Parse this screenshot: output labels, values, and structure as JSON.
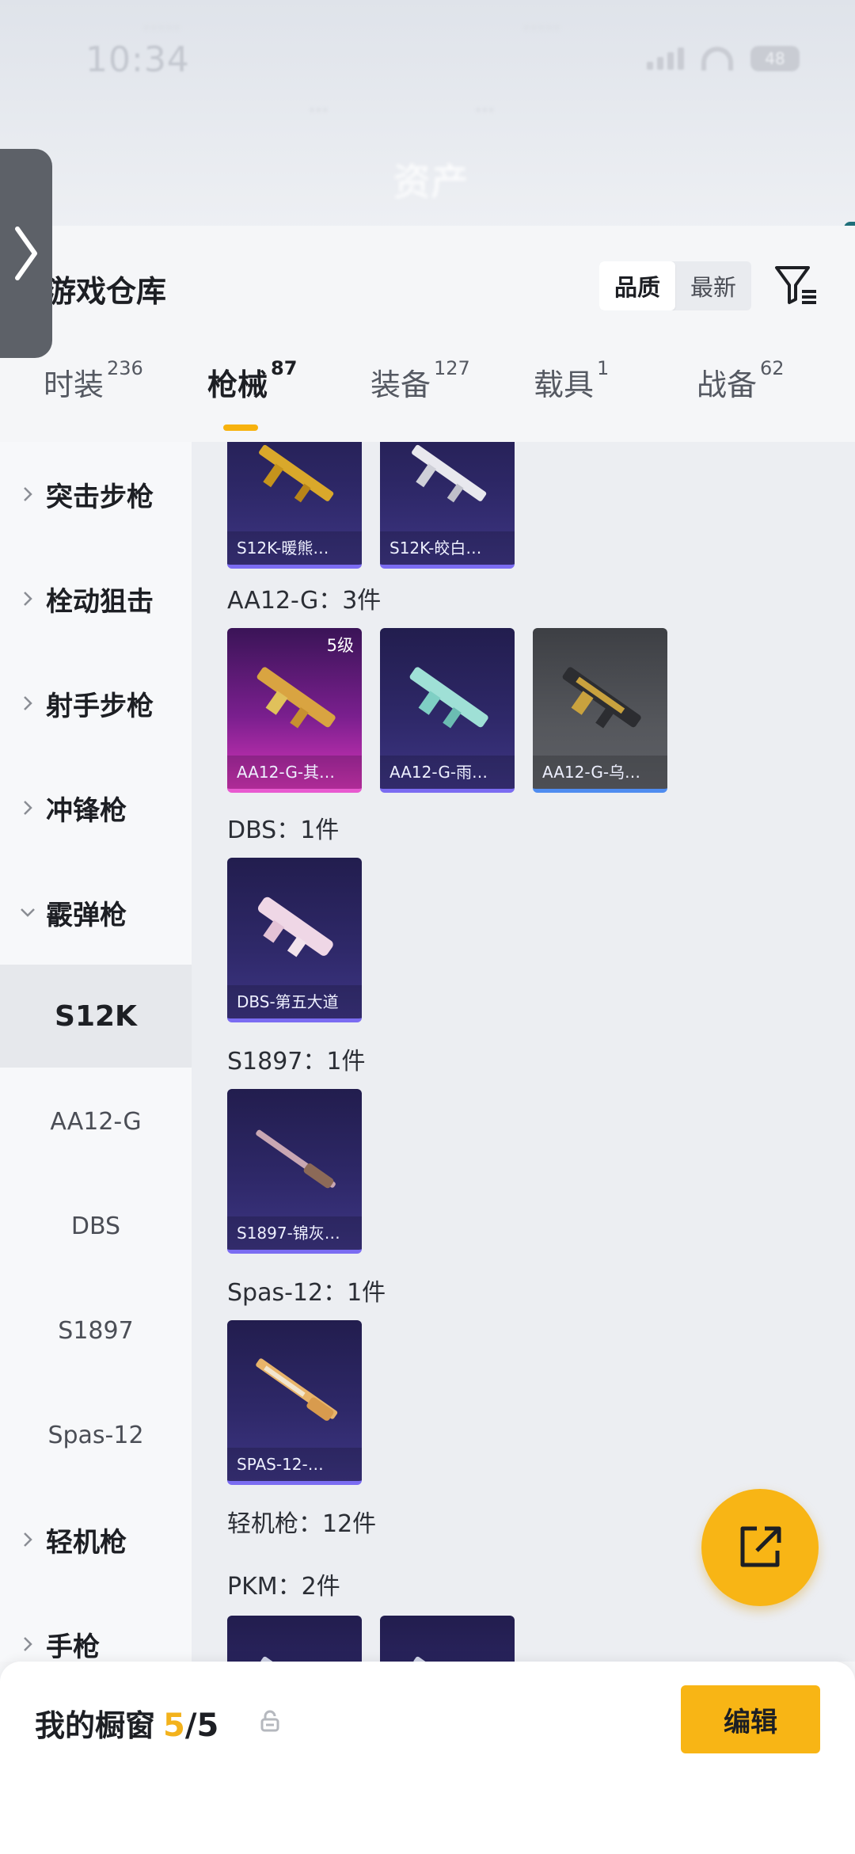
{
  "status": {
    "time": "10:34",
    "battery": "48"
  },
  "backdrop": {
    "title": "资产"
  },
  "header": {
    "title": "游戏仓库",
    "sort_options": [
      "品质",
      "最新"
    ]
  },
  "tabs": [
    {
      "label": "时装",
      "count": "236"
    },
    {
      "label": "枪械",
      "count": "87"
    },
    {
      "label": "装备",
      "count": "127"
    },
    {
      "label": "载具",
      "count": "1"
    },
    {
      "label": "战备",
      "count": "62"
    }
  ],
  "subnav": {
    "categories": [
      "突击步枪",
      "栓动狙击",
      "射手步枪",
      "冲锋枪",
      "霰弹枪"
    ],
    "selected": "S12K",
    "subitems": [
      "AA12-G",
      "DBS",
      "S1897",
      "Spas-12"
    ],
    "more_categories": [
      "轻机枪",
      "手枪"
    ]
  },
  "content": {
    "top_cards": [
      "S12K-暖熊…",
      "S12K-皎白…"
    ],
    "groups": [
      {
        "label": "AA12-G：3件",
        "cards": [
          {
            "name": "AA12-G-其…",
            "level": "5级",
            "style": "pink"
          },
          {
            "name": "AA12-G-雨…",
            "level": "",
            "style": "purple"
          },
          {
            "name": "AA12-G-乌…",
            "level": "",
            "style": "grey"
          }
        ]
      },
      {
        "label": "DBS：1件",
        "cards": [
          {
            "name": "DBS-第五大道",
            "level": "",
            "style": "purple"
          }
        ]
      },
      {
        "label": "S1897：1件",
        "cards": [
          {
            "name": "S1897-锦灰…",
            "level": "",
            "style": "purple"
          }
        ]
      },
      {
        "label": "Spas-12：1件",
        "cards": [
          {
            "name": "SPAS-12-…",
            "level": "",
            "style": "purple"
          }
        ]
      }
    ],
    "lmg_label": "轻机枪：12件",
    "pkm_label": "PKM：2件"
  },
  "bottom": {
    "showcase_title": "我的橱窗",
    "showcase_current": "5",
    "showcase_total": "/5",
    "edit_label": "编辑"
  },
  "colors": {
    "accent": "#f8b515",
    "tab_underline": "#f7b20e"
  },
  "icons": [
    "chevron-right-icon",
    "filter-icon",
    "share-icon",
    "lock-icon"
  ]
}
